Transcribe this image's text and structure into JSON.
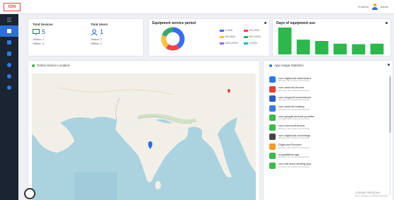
{
  "header": {
    "logo": "ION",
    "user_text": "Hi admin",
    "user_name": "Admin"
  },
  "sidebar": {
    "items": [
      "menu",
      "dashboard",
      "devices",
      "apps",
      "users",
      "settings",
      "info"
    ]
  },
  "totals": {
    "devices": {
      "label": "Total Devices",
      "value": "5",
      "online": "Online: 1",
      "offline": "Offline: 4"
    },
    "users": {
      "label": "Total Users",
      "value": "1",
      "online": "Online: 1",
      "offline": "Offline: 1"
    }
  },
  "pie_card": {
    "title": "Equipment service period",
    "legend": [
      "0-100h",
      "100-200h",
      "200-500h",
      "500-1000h",
      "1000-2000h",
      ">2000h"
    ]
  },
  "bar_card": {
    "title": "Days of equipment use"
  },
  "map_card": {
    "title": "Online Device Location"
  },
  "apps_card": {
    "title": "App Usage Statistics",
    "apps": [
      {
        "name": "com.digiboard.whiteboard",
        "time": "68 hours 38 minutes 46 seconds",
        "color": "#2f7be6"
      },
      {
        "name": "com.android.chrome",
        "time": "48 hours 48 minutes 02 seconds",
        "color": "#e44134"
      },
      {
        "name": "com.tongsoft.screenshare",
        "time": "38 hours 46 minutes 06 seconds",
        "color": "#2e5ec4"
      },
      {
        "name": "com.android.reading",
        "time": "18 hours 44 minutes 18 seconds",
        "color": "#3b7be0"
      },
      {
        "name": "com.google.android.youtube",
        "time": "10 hours 58 minutes 20 seconds",
        "color": "#3fb950"
      },
      {
        "name": "com.microsoft.teams",
        "time": "08 hours 42 minutes 12 seconds",
        "color": "#3fb950"
      },
      {
        "name": "com.digiboard.recordings",
        "time": "08 hours 02 minutes 31 seconds",
        "color": "#444444"
      },
      {
        "name": "Digiboard Browser",
        "time": "06 hours 18 minutes 49 seconds",
        "color": "#f29b2e"
      },
      {
        "name": "in.gaadibhai.app",
        "time": "04 hours 40 minutes 22 seconds",
        "color": "#3fb950"
      },
      {
        "name": "com.lab.learn.seating.app",
        "time": "02 hours 21 minutes 02 seconds",
        "color": "#3fb950"
      }
    ],
    "activate": {
      "line1": "Activate Windows",
      "line2": "Go to Settings to activate Windows."
    }
  },
  "colors": {
    "accent": "#2f7be6",
    "sidebar": "#1a2433",
    "green": "#2db84d"
  },
  "chart_data": [
    {
      "type": "pie",
      "title": "Equipment service period",
      "categories": [
        "0-100h",
        "100-200h",
        "200-500h",
        "500-1000h",
        "1000-2000h",
        ">2000h"
      ],
      "values": [
        40,
        20,
        20,
        20,
        0,
        0
      ],
      "colors": [
        "#3b6cf0",
        "#f0444b",
        "#f6c343",
        "#37a86b",
        "#8e6fd8",
        "#1fb7b7"
      ]
    },
    {
      "type": "bar",
      "title": "Days of equipment use",
      "categories": [
        "d1",
        "d2",
        "d3",
        "d4",
        "d5",
        "d6"
      ],
      "values": [
        10,
        5.5,
        5,
        4,
        3.8,
        4
      ],
      "ylim": [
        0,
        10
      ],
      "color": "#2db84d"
    }
  ]
}
